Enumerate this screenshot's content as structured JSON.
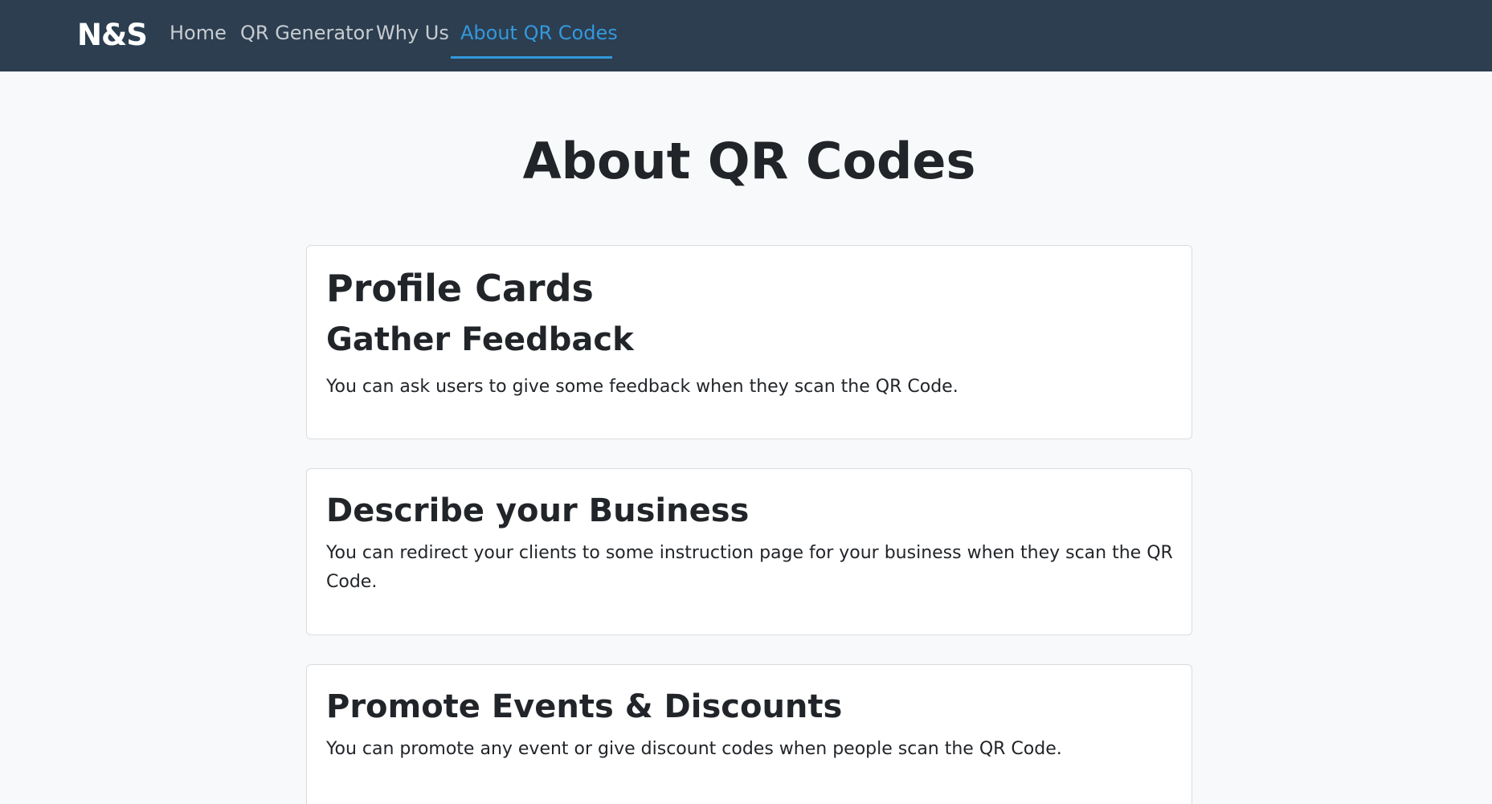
{
  "navbar": {
    "brand": "N&S",
    "links": [
      {
        "label": "Home",
        "active": false
      },
      {
        "label": "QR Generator",
        "active": false
      },
      {
        "label": "Why Us",
        "active": false
      },
      {
        "label": "About QR Codes",
        "active": true
      }
    ],
    "background_color": "#2c3e50",
    "active_color": "#3498db"
  },
  "main": {
    "title": "About QR Codes",
    "cards": [
      {
        "heading": "Profile Cards",
        "subheading": "Gather Feedback",
        "text": "You can ask users to give some feedback when they scan the QR Code."
      },
      {
        "heading": "Describe your Business",
        "text": "You can redirect your clients to some instruction page for your business when they scan the QR Code."
      },
      {
        "heading": "Promote Events & Discounts",
        "text": "You can promote any event or give discount codes when people scan the QR Code."
      }
    ]
  }
}
